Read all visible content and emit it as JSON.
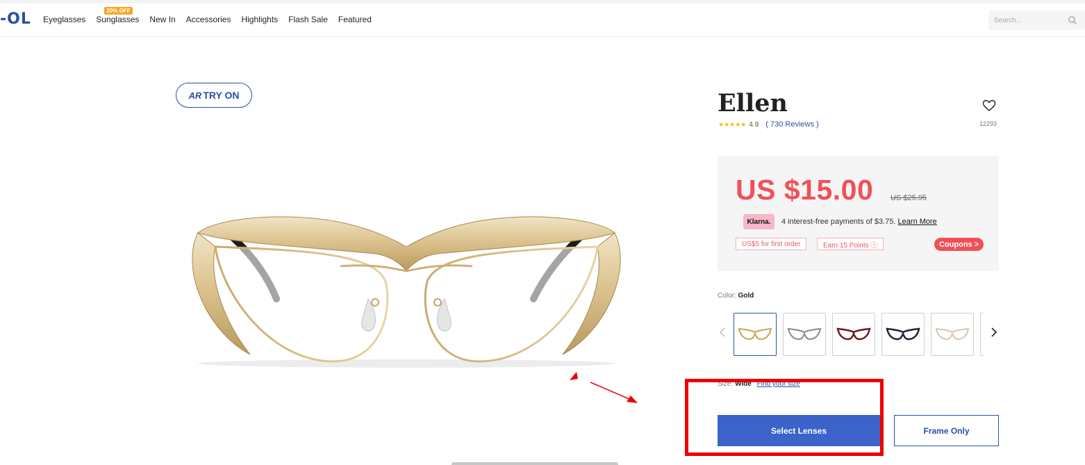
{
  "header": {
    "logo": "-OL",
    "nav": [
      {
        "label": "Eyeglasses"
      },
      {
        "label": "Sunglasses",
        "badge": "20% OFF"
      },
      {
        "label": "New In"
      },
      {
        "label": "Accessories"
      },
      {
        "label": "Highlights"
      },
      {
        "label": "Flash Sale"
      },
      {
        "label": "Featured"
      }
    ],
    "search_placeholder": "Search...",
    "search_icon": "search-icon"
  },
  "tryon": {
    "label": "TRY ON",
    "icon_text": "AR"
  },
  "product": {
    "name": "Ellen",
    "stars": "★★★★★",
    "rating": "4.9",
    "reviews": "( 730 Reviews )",
    "favorites": "12293",
    "price": "US $15.00",
    "original_price": "US $25.95",
    "klarna": {
      "badge": "Klarna.",
      "text": "4 interest-free payments of $3.75.",
      "link": "Learn More"
    },
    "tags": [
      "US$5 for first order",
      "Earn 15 Points ⓘ"
    ],
    "coupons": "Coupons >",
    "color_label": "Color:",
    "color_value": "Gold",
    "swatches": [
      {
        "color": "gold",
        "stroke": "#c9a55a"
      },
      {
        "color": "silver",
        "stroke": "#8a8a8a"
      },
      {
        "color": "burgundy",
        "stroke": "#6b1a22"
      },
      {
        "color": "black",
        "stroke": "#1e2433"
      },
      {
        "color": "champagne",
        "stroke": "#d8c8b0"
      },
      {
        "color": "partial",
        "stroke": "#999999"
      }
    ],
    "size_label": "Size:",
    "size_value": "Wide",
    "size_link": "Find your size",
    "select_lenses": "Select Lenses",
    "frame_only": "Frame Only"
  },
  "colors": {
    "brand_blue": "#2b4ea6",
    "button_blue": "#3b63c9",
    "price_red": "#f05159",
    "annotation_red": "#ee0000",
    "badge_orange": "#f6a623",
    "klarna_pink": "#f6b7c8"
  }
}
